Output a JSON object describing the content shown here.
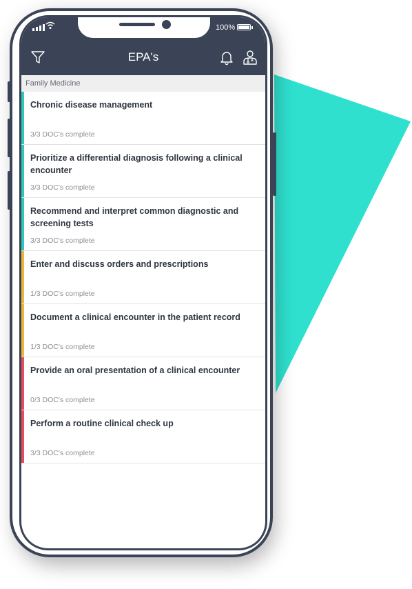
{
  "app": {
    "title": "EPA's",
    "battery": "100%"
  },
  "section": {
    "label": "Family Medicine"
  },
  "colors": {
    "complete": "#2fc7b8",
    "partial": "#e8b83a",
    "incomplete": "#e94a5c",
    "header": "#3a4456",
    "accent_shape": "#2fe0cf"
  },
  "icons": {
    "filter": "filter-icon",
    "notifications": "bell-icon",
    "profile": "doctor-profile-icon"
  },
  "items": [
    {
      "title": "Chronic disease management",
      "status": "3/3 DOC's complete",
      "state": "complete"
    },
    {
      "title": "Prioritize a differential diagnosis following a clinical encounter",
      "status": "3/3 DOC's complete",
      "state": "complete"
    },
    {
      "title": "Recommend and interpret common diagnostic and screening tests",
      "status": "3/3 DOC's complete",
      "state": "complete"
    },
    {
      "title": "Enter and discuss orders and prescriptions",
      "status": "1/3 DOC's complete",
      "state": "partial"
    },
    {
      "title": "Document a clinical encounter in the patient record",
      "status": "1/3 DOC's complete",
      "state": "partial"
    },
    {
      "title": "Provide an oral presentation of a clinical encounter",
      "status": "0/3 DOC's complete",
      "state": "incomplete"
    },
    {
      "title": "Perform a routine clinical check up",
      "status": "3/3 DOC's complete",
      "state": "incomplete"
    }
  ]
}
